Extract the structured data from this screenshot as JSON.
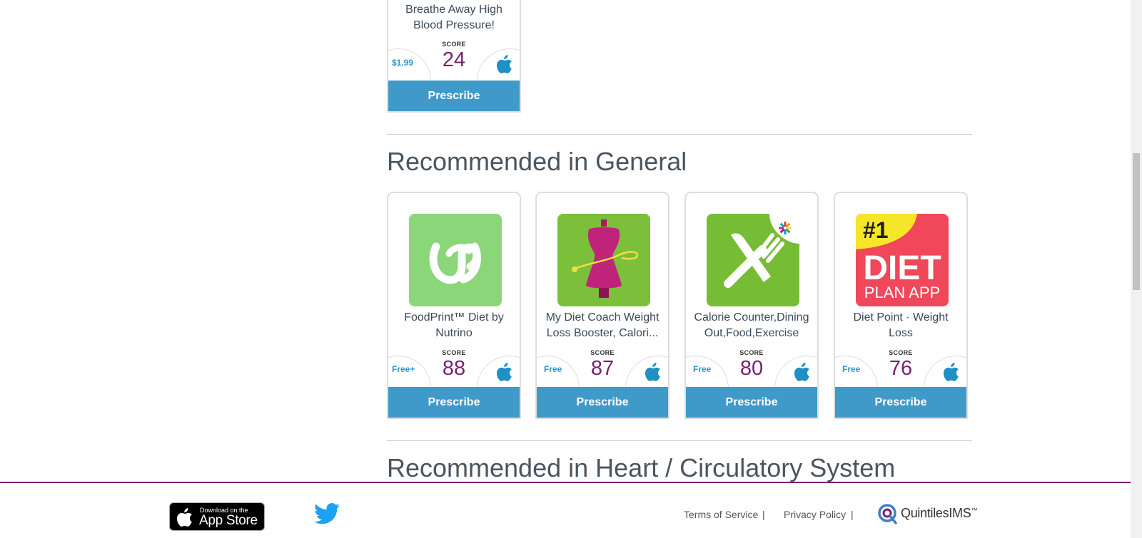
{
  "top_card": {
    "name": "Breathe Away High Blood Pressure!",
    "score_label": "SCORE",
    "score": "24",
    "price": "$1.99",
    "button": "Prescribe"
  },
  "sections": [
    {
      "title": "Recommended in General",
      "cards": [
        {
          "name": "FoodPrint™ Diet by Nutrino",
          "score_label": "SCORE",
          "score": "88",
          "price": "Free+",
          "button": "Prescribe"
        },
        {
          "name": "My Diet Coach Weight Loss Booster, Calori...",
          "score_label": "SCORE",
          "score": "87",
          "price": "Free",
          "button": "Prescribe"
        },
        {
          "name": "Calorie Counter,Dining Out,Food,Exercise",
          "score_label": "SCORE",
          "score": "80",
          "price": "Free",
          "button": "Prescribe"
        },
        {
          "name": "Diet Point · Weight Loss",
          "score_label": "SCORE",
          "score": "76",
          "price": "Free",
          "button": "Prescribe"
        }
      ]
    },
    {
      "title": "Recommended in Heart / Circulatory System"
    }
  ],
  "diet_logo": {
    "badge": "#1",
    "line1": "DIET",
    "line2": "PLAN APP"
  },
  "footer": {
    "appstore_small": "Download on the",
    "appstore_big": "App Store",
    "terms": "Terms of Service",
    "privacy": "Privacy Policy",
    "separator": "|",
    "brand": "QuintilesIMS",
    "brand_tm": "™"
  },
  "colors": {
    "button": "#3f9ac9",
    "score": "#7a1f6e",
    "price": "#2a9ac8",
    "footer_rule": "#7a1f6e"
  },
  "icons": [
    "apple-icon",
    "twitter-icon",
    "quintiles-logo-icon"
  ]
}
